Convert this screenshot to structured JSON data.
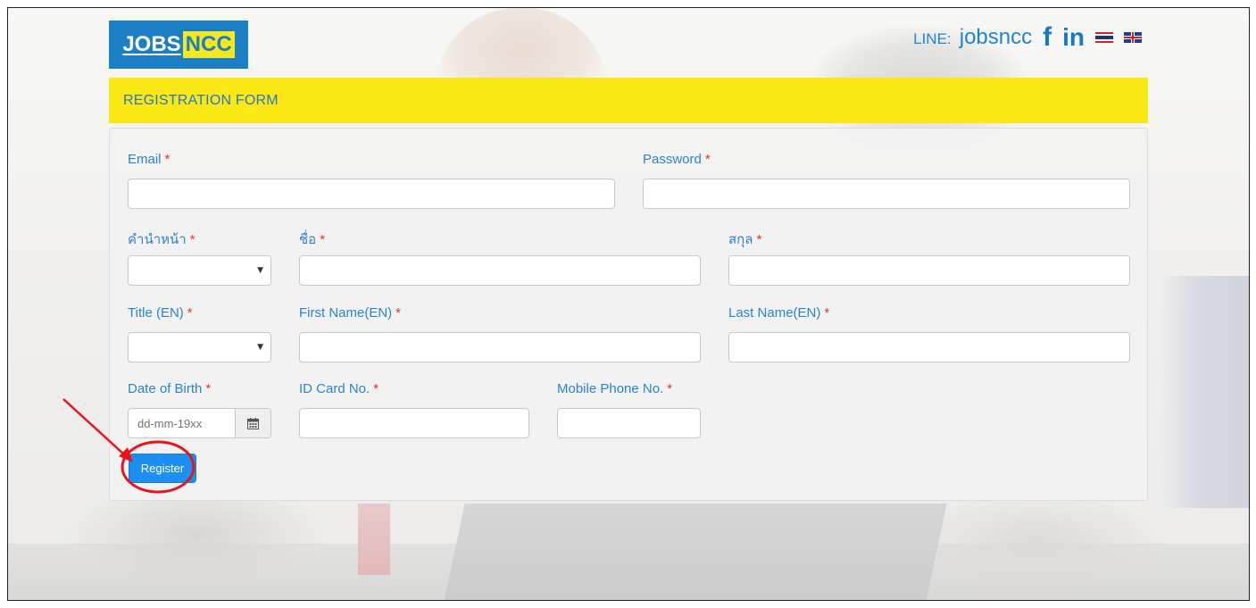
{
  "brand": {
    "logo_jobs": "JOBS",
    "logo_ncc": "NCC",
    "line_label": "LINE:",
    "line_id": "jobsncc",
    "facebook_glyph": "f",
    "linkedin_glyph": "in",
    "lang_th_flag": "thailand-flag-icon",
    "lang_en_flag": "uk-flag-icon"
  },
  "form": {
    "title": "REGISTRATION FORM",
    "required_mark": "*",
    "email_label": "Email",
    "password_label": "Password",
    "th_prefix_label": "คำนำหน้า",
    "th_first_label": "ชื่อ",
    "th_last_label": "สกุล",
    "title_en_label": "Title (EN)",
    "first_en_label": "First Name(EN)",
    "last_en_label": "Last Name(EN)",
    "dob_label": "Date of Birth",
    "dob_placeholder": "dd-mm-19xx",
    "id_card_label": "ID Card No.",
    "mobile_label": "Mobile Phone No.",
    "register_label": "Register"
  },
  "colors": {
    "header_yellow": "#f9e814",
    "label_blue": "#2c82cf",
    "required_red": "#e4322b",
    "button_blue": "#1e8ff2",
    "annotation_red": "#e8141a"
  }
}
